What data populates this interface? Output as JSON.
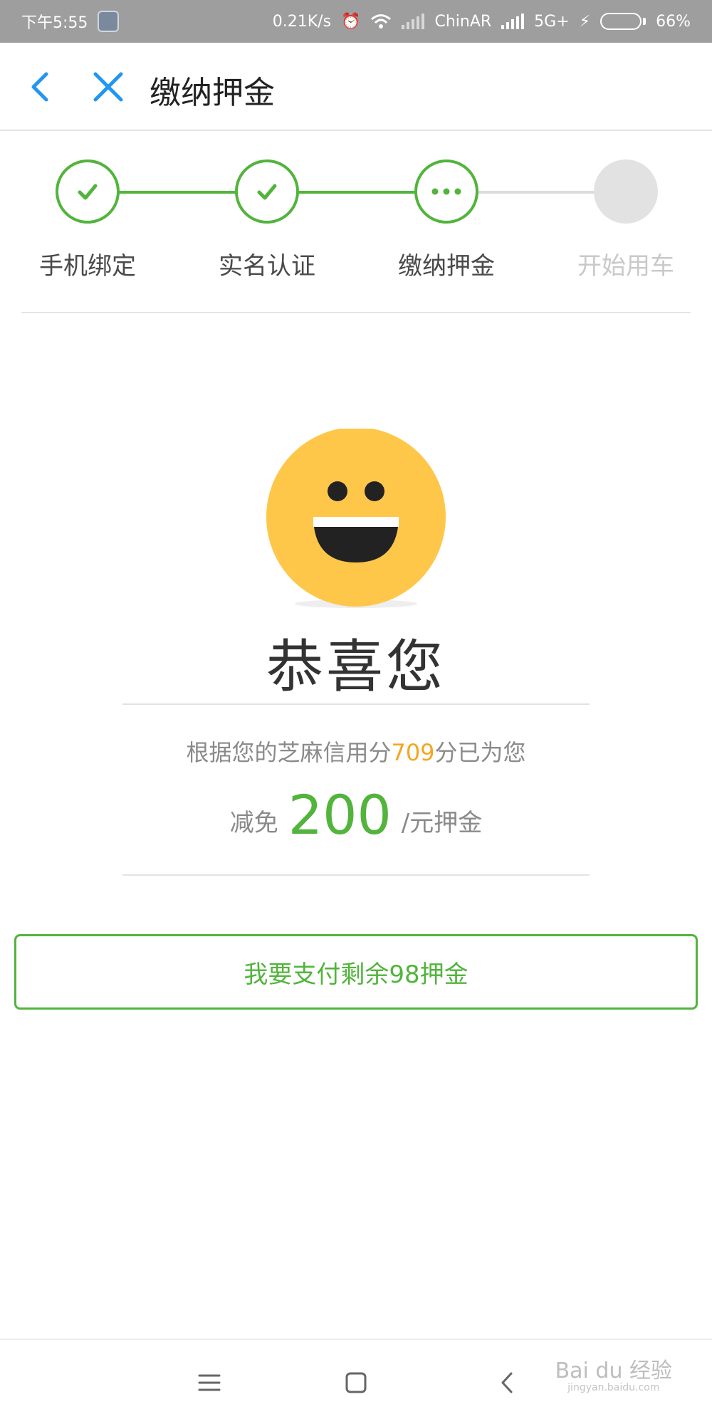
{
  "status_bar": {
    "time": "下午5:55",
    "network_speed": "0.21K/s",
    "carrier": "ChinAR",
    "network_type": "5G+",
    "battery": "66%",
    "battery_level": 0.66
  },
  "header": {
    "title": "缴纳押金"
  },
  "steps": [
    {
      "label": "手机绑定",
      "state": "done"
    },
    {
      "label": "实名认证",
      "state": "done"
    },
    {
      "label": "缴纳押金",
      "state": "current"
    },
    {
      "label": "开始用车",
      "state": "todo"
    }
  ],
  "colors": {
    "accent_green": "#52b43c",
    "score_orange": "#f5a623",
    "smiley_yellow": "#ffc74a",
    "back_blue": "#2196f3"
  },
  "result": {
    "title": "恭喜您",
    "credit_prefix": "根据您的芝麻信用分",
    "credit_score": "709",
    "credit_suffix": "分已为您",
    "reduce_prefix": "减免",
    "reduce_amount": "200",
    "reduce_suffix": "/元押金"
  },
  "pay_button": {
    "label": "我要支付剩余98押金"
  },
  "watermark": {
    "text": "Bai du 经验",
    "sub": "jingyan.baidu.com"
  },
  "icons": {
    "back": "back-arrow-icon",
    "close": "close-icon",
    "check": "check-icon",
    "ellipsis": "ellipsis-icon",
    "menu": "menu-icon",
    "home": "home-icon",
    "nav_back": "nav-back-icon"
  }
}
